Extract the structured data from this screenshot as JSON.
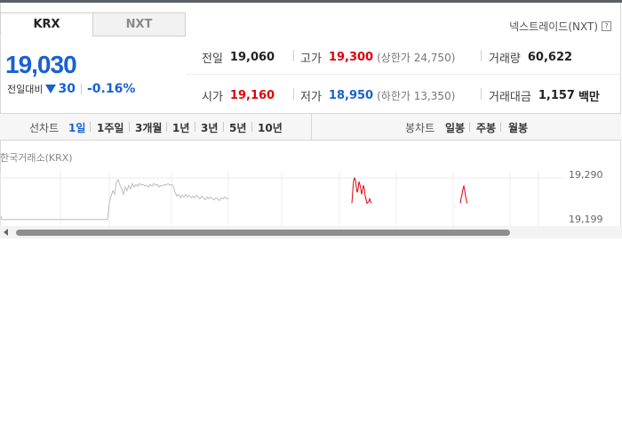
{
  "tabs": [
    {
      "label": "KRX",
      "active": true
    },
    {
      "label": "NXT",
      "active": false
    }
  ],
  "nxt_link": {
    "label": "넥스트레이드(NXT)",
    "help_glyph": "?"
  },
  "price": {
    "current": "19,030",
    "change_label": "전일대비",
    "change_value": "30",
    "change_percent": "-0.16%",
    "direction": "down",
    "color_down": "#1961d1",
    "color_up": "#e0000b"
  },
  "stats": {
    "prev_close": {
      "label": "전일",
      "value": "19,060"
    },
    "high": {
      "label": "고가",
      "value": "19,300",
      "sub": "(상한가 24,750)"
    },
    "volume": {
      "label": "거래량",
      "value": "60,622"
    },
    "open": {
      "label": "시가",
      "value": "19,160"
    },
    "low": {
      "label": "저가",
      "value": "18,950",
      "sub": "(하한가 13,350)"
    },
    "amount": {
      "label": "거래대금",
      "value": "1,157",
      "unit": "백만"
    }
  },
  "toolbar": {
    "line_chart_label": "선차트",
    "periods": [
      "1일",
      "1주일",
      "3개월",
      "1년",
      "3년",
      "5년",
      "10년"
    ],
    "selected_period": "1일",
    "candle_chart_label": "봉차트",
    "candle_periods": [
      "일봉",
      "주봉",
      "월봉"
    ]
  },
  "chart_source": "한국거래소(KRX)",
  "chart_data": {
    "type": "line",
    "y_ticks": [
      "19,290",
      "19,199"
    ],
    "ylim": [
      19000,
      19310
    ],
    "series": [
      {
        "color": "#bdbdbd",
        "points": [
          [
            1,
            19080
          ],
          [
            2,
            19060
          ],
          [
            121,
            19060
          ],
          [
            123,
            19150
          ],
          [
            125,
            19190
          ],
          [
            127,
            19220
          ],
          [
            129,
            19200
          ],
          [
            131,
            19270
          ],
          [
            133,
            19280
          ],
          [
            135,
            19250
          ],
          [
            137,
            19230
          ],
          [
            139,
            19200
          ],
          [
            141,
            19240
          ],
          [
            143,
            19220
          ],
          [
            145,
            19250
          ],
          [
            147,
            19230
          ],
          [
            149,
            19260
          ],
          [
            151,
            19240
          ],
          [
            153,
            19255
          ],
          [
            155,
            19245
          ],
          [
            157,
            19260
          ],
          [
            159,
            19250
          ],
          [
            161,
            19255
          ],
          [
            163,
            19245
          ],
          [
            165,
            19250
          ],
          [
            167,
            19240
          ],
          [
            169,
            19255
          ],
          [
            171,
            19245
          ],
          [
            173,
            19260
          ],
          [
            175,
            19250
          ],
          [
            177,
            19255
          ],
          [
            179,
            19240
          ],
          [
            181,
            19250
          ],
          [
            183,
            19245
          ],
          [
            185,
            19255
          ],
          [
            187,
            19250
          ],
          [
            189,
            19260
          ],
          [
            191,
            19250
          ],
          [
            193,
            19255
          ],
          [
            195,
            19245
          ],
          [
            197,
            19210
          ],
          [
            199,
            19190
          ],
          [
            201,
            19200
          ],
          [
            203,
            19180
          ],
          [
            205,
            19195
          ],
          [
            207,
            19185
          ],
          [
            209,
            19200
          ],
          [
            211,
            19185
          ],
          [
            213,
            19195
          ],
          [
            215,
            19180
          ],
          [
            217,
            19190
          ],
          [
            219,
            19180
          ],
          [
            221,
            19195
          ],
          [
            223,
            19185
          ],
          [
            225,
            19175
          ],
          [
            227,
            19190
          ],
          [
            229,
            19180
          ],
          [
            231,
            19170
          ],
          [
            233,
            19185
          ],
          [
            235,
            19175
          ],
          [
            237,
            19185
          ],
          [
            239,
            19175
          ],
          [
            241,
            19170
          ],
          [
            243,
            19180
          ],
          [
            245,
            19175
          ],
          [
            247,
            19165
          ],
          [
            249,
            19180
          ],
          [
            251,
            19175
          ],
          [
            253,
            19185
          ],
          [
            255,
            19175
          ],
          [
            257,
            19180
          ]
        ]
      },
      {
        "color": "#e0000b",
        "points": [
          [
            396,
            19150
          ],
          [
            397,
            19220
          ],
          [
            398,
            19275
          ],
          [
            399,
            19290
          ],
          [
            400,
            19280
          ],
          [
            401,
            19240
          ],
          [
            402,
            19210
          ],
          [
            403,
            19230
          ],
          [
            404,
            19270
          ],
          [
            405,
            19255
          ],
          [
            406,
            19230
          ],
          [
            407,
            19200
          ],
          [
            408,
            19225
          ],
          [
            409,
            19250
          ],
          [
            410,
            19230
          ],
          [
            411,
            19190
          ],
          [
            412,
            19170
          ],
          [
            413,
            19150
          ],
          [
            415,
            19160
          ],
          [
            416,
            19175
          ],
          [
            417,
            19160
          ],
          [
            418,
            19150
          ]
        ]
      },
      {
        "color": "#e0000b",
        "points": [
          [
            518,
            19150
          ],
          [
            519,
            19180
          ],
          [
            520,
            19200
          ],
          [
            521,
            19230
          ],
          [
            522,
            19245
          ],
          [
            523,
            19220
          ],
          [
            524,
            19190
          ],
          [
            525,
            19160
          ],
          [
            526,
            19150
          ]
        ]
      }
    ]
  }
}
